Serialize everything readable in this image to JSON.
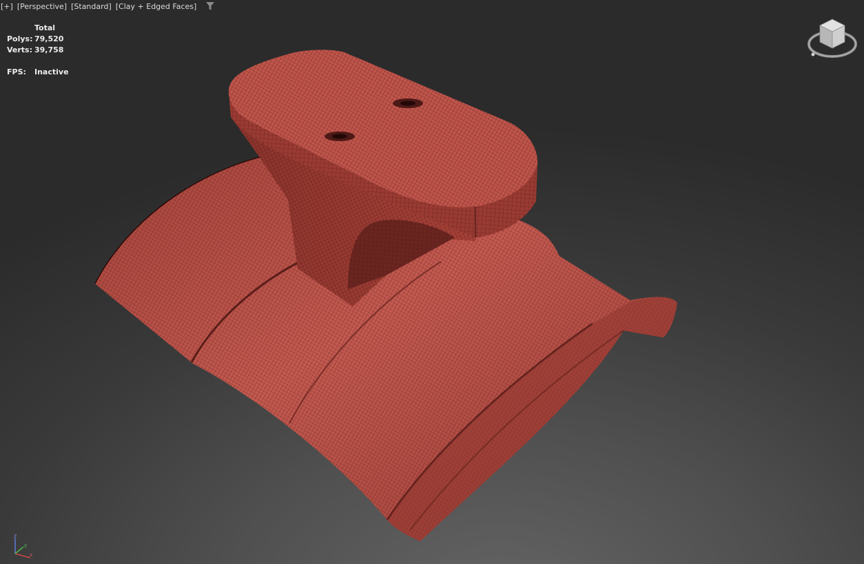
{
  "viewport": {
    "menus": [
      "[+]",
      "[Perspective]",
      "[Standard]",
      "[Clay + Edged Faces]"
    ],
    "filter_icon": "funnel-icon"
  },
  "stats": {
    "header": "Total",
    "polys_label": "Polys:",
    "polys_value": "79,520",
    "verts_label": "Verts:",
    "verts_value": "39,758",
    "fps_label": "FPS:",
    "fps_value": "Inactive"
  },
  "viewcube": {
    "icon": "viewcube-icon"
  },
  "axis_gizmo": {
    "icon": "axis-tripod-icon",
    "z_label": "z",
    "y_label": "y",
    "x_label": "x"
  },
  "colors": {
    "mesh_fill": "#b34b43",
    "mesh_shadow": "#7c2d27",
    "wire": "#3a100e",
    "background": "#3a3a3a"
  }
}
